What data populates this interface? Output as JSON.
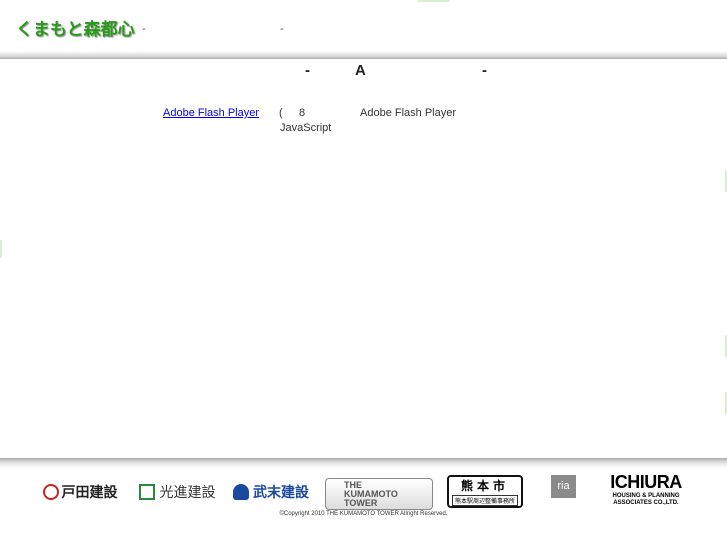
{
  "header": {
    "logo": "くまもと森都心",
    "sep1": "-",
    "sep2": "-"
  },
  "main": {
    "title_left": "-",
    "title_mid": "A",
    "title_right": "-",
    "flash_link": "Adobe Flash Player",
    "paren": "(",
    "version": "8",
    "flash_text": "Adobe Flash Player",
    "js": "JavaScript"
  },
  "footer": {
    "sponsors": [
      "戸田建設",
      "光進建設",
      "武末建設",
      "THE KUMAMOTO TOWER",
      "熊本市",
      "ria",
      "ICHIURA"
    ],
    "kumamoto_sub": "熊本駅周辺整備事務所",
    "ichiura_sub": "HOUSING & PLANNING ASSOCIATES CO.,LTD.",
    "copyright": "©Copyright 2010 THE KUMAMOTO TOWER Allright Reserved."
  },
  "colors": {
    "logo": "#2a9a1a",
    "link": "#0000ee"
  }
}
